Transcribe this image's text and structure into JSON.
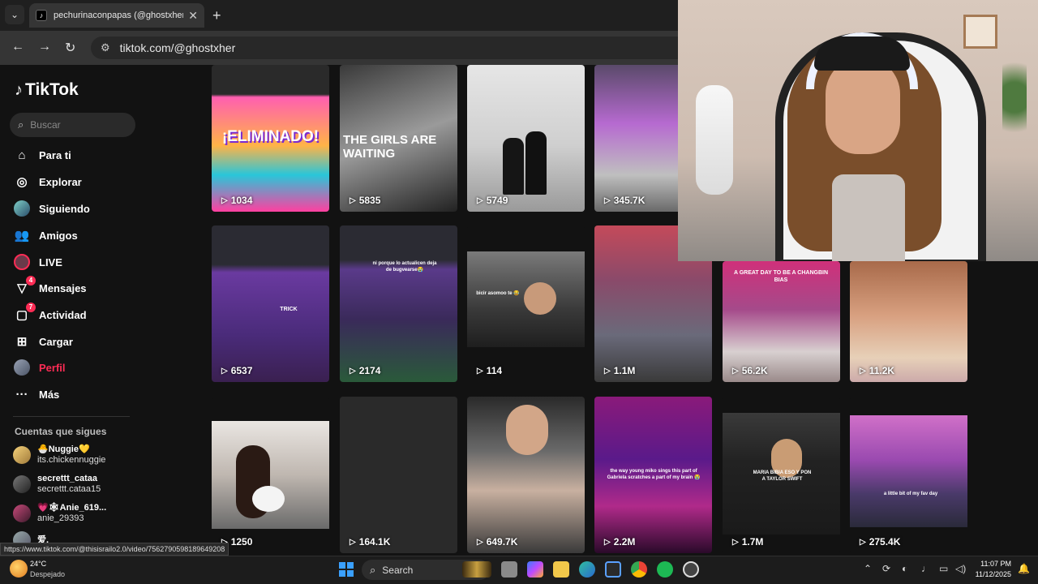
{
  "browser": {
    "tab_title": "pechurinaconpapas (@ghostxher) | TikTok",
    "tab_favicon": "tiktok-icon",
    "url": "tiktok.com/@ghostxher",
    "status_url": "https://www.tiktok.com/@thisisrailo2.0/video/7562790598189649208"
  },
  "tiktok": {
    "logo": "TikTok",
    "search_placeholder": "Buscar",
    "nav": [
      {
        "label": "Para ti",
        "icon": "home-icon"
      },
      {
        "label": "Explorar",
        "icon": "compass-icon"
      },
      {
        "label": "Siguiendo",
        "icon": "following-avatar-icon"
      },
      {
        "label": "Amigos",
        "icon": "friends-icon"
      },
      {
        "label": "LIVE",
        "icon": "live-icon"
      },
      {
        "label": "Mensajes",
        "icon": "messages-icon",
        "badge": "4"
      },
      {
        "label": "Actividad",
        "icon": "activity-icon",
        "badge": "7"
      },
      {
        "label": "Cargar",
        "icon": "upload-icon"
      },
      {
        "label": "Perfil",
        "icon": "profile-avatar-icon"
      },
      {
        "label": "Más",
        "icon": "more-icon"
      }
    ],
    "following_title": "Cuentas que sigues",
    "following": [
      {
        "name": "🐣Nuggie💛",
        "handle": "its.chickennuggie"
      },
      {
        "name": "secrettt_cataa",
        "handle": "secrettt.cataa15"
      },
      {
        "name": "💗🕸Anie_619...",
        "handle": "anie_29393"
      },
      {
        "name": "爱.",
        "handle": ""
      }
    ],
    "videos": [
      {
        "views": "1034",
        "caption": "¡ELIMINADO!"
      },
      {
        "views": "5835",
        "caption": "THE GIRLS ARE WAITING"
      },
      {
        "views": "5749",
        "caption": ""
      },
      {
        "views": "345.7K",
        "caption": ""
      },
      {
        "views": "6537",
        "caption": "TRICK"
      },
      {
        "views": "2174",
        "caption": "ni porque lo actualicen deja de bugvearse😭"
      },
      {
        "views": "114",
        "caption": "bicir asomoo te 😂"
      },
      {
        "views": "1.1M",
        "caption": ""
      },
      {
        "views": "56.2K",
        "caption": "A GREAT DAY TO BE A CHANGBIN BIAS"
      },
      {
        "views": "11.2K",
        "caption": ""
      },
      {
        "views": "1250",
        "caption": ""
      },
      {
        "views": "164.1K",
        "caption": ""
      },
      {
        "views": "649.7K",
        "caption": ""
      },
      {
        "views": "2.2M",
        "caption": "the way young miko sings this part of Gabriela scratches a part of my brain 😭"
      },
      {
        "views": "1.7M",
        "caption": "MARIA BIBIA ESO Y PON A TAYLOR SWIFT"
      },
      {
        "views": "275.4K",
        "caption": "a little bit of my fav day"
      }
    ],
    "watermark": "ghostxher"
  },
  "taskbar": {
    "temperature": "24°C",
    "weather": "Despejado",
    "search": "Search",
    "time": "11:07 PM",
    "date": "11/12/2025"
  }
}
